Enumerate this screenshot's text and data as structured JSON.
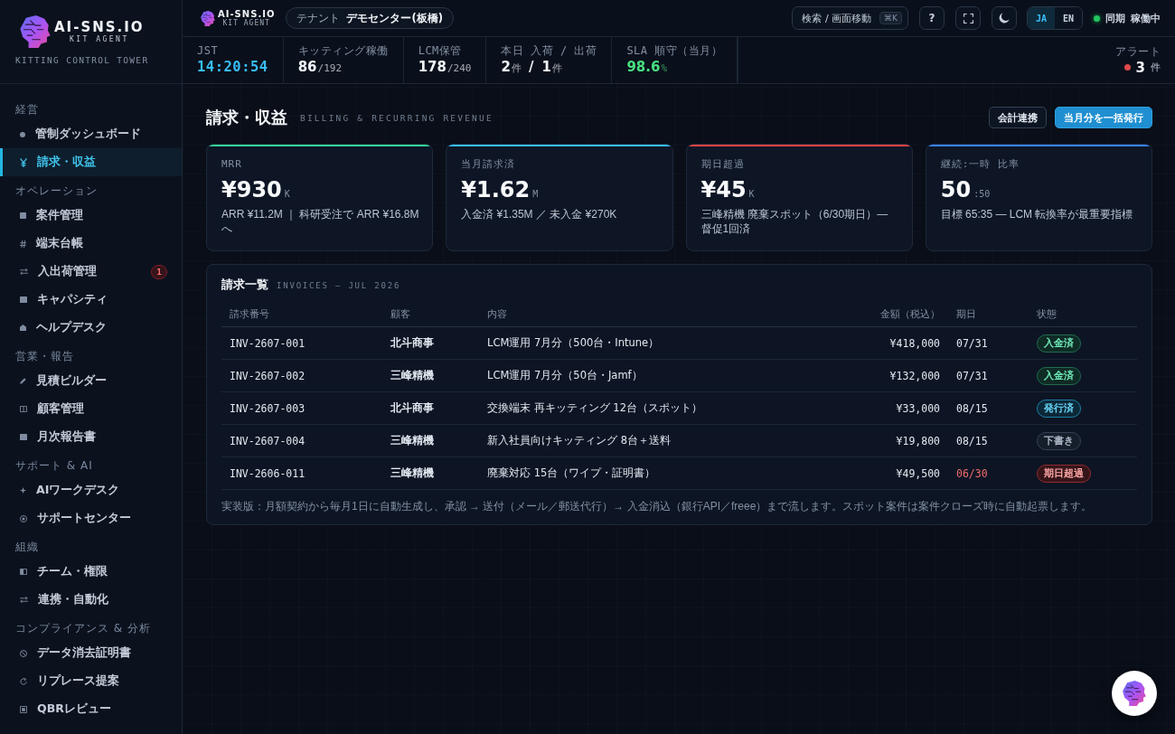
{
  "sidebar": {
    "brand": {
      "name": "AI-SNS.IO",
      "tagline": "KIT AGENT"
    },
    "subtitle": "KITTING CONTROL TOWER",
    "sections": [
      {
        "title": "経営",
        "items": [
          {
            "kind": "dot",
            "label": "管制ダッシュボード",
            "selected": false
          },
          {
            "kind": "yen",
            "label": "請求・収益",
            "selected": true
          }
        ]
      },
      {
        "title": "オペレーション",
        "items": [
          {
            "kind": "square",
            "label": "案件管理",
            "selected": false
          },
          {
            "kind": "hash",
            "label": "端末台帳",
            "selected": false
          },
          {
            "kind": "swap",
            "label": "入出荷管理",
            "selected": false,
            "badge": "1"
          },
          {
            "kind": "block",
            "label": "キャパシティ",
            "selected": false
          },
          {
            "kind": "house",
            "label": "ヘルプデスク",
            "selected": false
          }
        ]
      },
      {
        "title": "営業・報告",
        "items": [
          {
            "kind": "pencil",
            "label": "見積ビルダー",
            "selected": false
          },
          {
            "kind": "columns",
            "label": "顧客管理",
            "selected": false
          },
          {
            "kind": "block",
            "label": "月次報告書",
            "selected": false
          }
        ]
      },
      {
        "title": "サポート & AI",
        "items": [
          {
            "kind": "sparkle",
            "label": "AIワークデスク",
            "selected": false
          },
          {
            "kind": "target",
            "label": "サポートセンター",
            "selected": false
          }
        ]
      },
      {
        "title": "組織",
        "items": [
          {
            "kind": "halfsquare",
            "label": "チーム・権限",
            "selected": false
          },
          {
            "kind": "swap",
            "label": "連携・自動化",
            "selected": false
          }
        ]
      },
      {
        "title": "コンプライアンス & 分析",
        "items": [
          {
            "kind": "ban",
            "label": "データ消去証明書",
            "selected": false
          },
          {
            "kind": "refresh",
            "label": "リプレース提案",
            "selected": false
          },
          {
            "kind": "frame",
            "label": "QBRレビュー",
            "selected": false
          }
        ]
      }
    ]
  },
  "topbar": {
    "brand": {
      "name": "AI-SNS.IO",
      "tagline": "KIT AGENT"
    },
    "tenant": {
      "label": "テナント",
      "value": "デモセンター(板橋)"
    },
    "search": {
      "label": "検索 / 画面移動",
      "shortcut": "⌘K"
    },
    "help": "?",
    "languages": [
      {
        "label": "JA",
        "selected": true
      },
      {
        "label": "EN",
        "selected": false
      }
    ],
    "sync": {
      "label": "同期",
      "value": "稼働中",
      "online": true
    }
  },
  "stats": [
    {
      "label": "JST",
      "color": "#38bdf8",
      "segments": [
        {
          "kind": "num",
          "text": "14:20:54"
        }
      ]
    },
    {
      "label": "キッティング稼働",
      "color": "#f1f5f9",
      "segments": [
        {
          "kind": "num",
          "text": "86"
        },
        {
          "kind": "unit",
          "text": "/192"
        }
      ]
    },
    {
      "label": "LCM保管",
      "color": "#f1f5f9",
      "segments": [
        {
          "kind": "num",
          "text": "178"
        },
        {
          "kind": "unit",
          "text": "/240"
        }
      ]
    },
    {
      "label": "本日 入荷 / 出荷",
      "color": "#f1f5f9",
      "segments": [
        {
          "kind": "num",
          "text": "2"
        },
        {
          "kind": "unit",
          "text": "件"
        },
        {
          "kind": "sep",
          "text": "/"
        },
        {
          "kind": "num",
          "text": "1"
        },
        {
          "kind": "unit",
          "text": "件"
        }
      ]
    },
    {
      "label": "SLA 順守（当月）",
      "color": "#4ade80",
      "segments": [
        {
          "kind": "num",
          "text": "98.6"
        },
        {
          "kind": "unit",
          "text": "%"
        }
      ]
    }
  ],
  "alert": {
    "label": "アラート",
    "count": "3",
    "unit": "件"
  },
  "page": {
    "title": "請求・収益",
    "subtitle": "BILLING & RECURRING REVENUE",
    "actions": [
      {
        "label": "会計連携",
        "kind": "secondary"
      },
      {
        "label": "当月分を一括発行",
        "kind": "primary"
      }
    ]
  },
  "kpis": [
    {
      "label": "MRR",
      "value": "¥930",
      "unit": "K",
      "note": "ARR ¥11.2M ｜ 科研受注で ARR ¥16.8M へ",
      "color": "#34d399"
    },
    {
      "label": "当月請求済",
      "value": "¥1.62",
      "unit": "M",
      "note": "入金済 ¥1.35M ／ 未入金 ¥270K",
      "color": "#38bdf8"
    },
    {
      "label": "期日超過",
      "value": "¥45",
      "unit": "K",
      "note": "三峰精機 廃棄スポット（6/30期日）— 督促1回済",
      "color": "#ef4444"
    },
    {
      "label": "継続:一時 比率",
      "value": "50",
      "unit": ":50",
      "note": "目標 65:35 — LCM 転換率が最重要指標",
      "color": "#3b82f6"
    }
  ],
  "invoices": {
    "title": "請求一覧",
    "subtitle": "INVOICES — JUL 2026",
    "columns": [
      "請求番号",
      "顧客",
      "内容",
      "金額（税込）",
      "期日",
      "状態"
    ],
    "rows": [
      {
        "number": "INV-2607-001",
        "customer": "北斗商事",
        "description": "LCM運用 7月分（500台・Intune）",
        "amount": "¥418,000",
        "due": "07/31",
        "overdue": false,
        "status": {
          "label": "入金済",
          "kind": "paid"
        }
      },
      {
        "number": "INV-2607-002",
        "customer": "三峰精機",
        "description": "LCM運用 7月分（50台・Jamf）",
        "amount": "¥132,000",
        "due": "07/31",
        "overdue": false,
        "status": {
          "label": "入金済",
          "kind": "paid"
        }
      },
      {
        "number": "INV-2607-003",
        "customer": "北斗商事",
        "description": "交換端末 再キッティング 12台（スポット）",
        "amount": "¥33,000",
        "due": "08/15",
        "overdue": false,
        "status": {
          "label": "発行済",
          "kind": "issued"
        }
      },
      {
        "number": "INV-2607-004",
        "customer": "三峰精機",
        "description": "新入社員向けキッティング 8台＋送料",
        "amount": "¥19,800",
        "due": "08/15",
        "overdue": false,
        "status": {
          "label": "下書き",
          "kind": "draft"
        }
      },
      {
        "number": "INV-2606-011",
        "customer": "三峰精機",
        "description": "廃棄対応 15台（ワイプ・証明書）",
        "amount": "¥49,500",
        "due": "06/30",
        "overdue": true,
        "status": {
          "label": "期日超過",
          "kind": "overdue"
        }
      }
    ],
    "note": "実装版：月額契約から毎月1日に自動生成し、承認 → 送付（メール／郵送代行）→ 入金消込（銀行API／freee）まで流します。スポット案件は案件クローズ時に自動起票します。"
  }
}
